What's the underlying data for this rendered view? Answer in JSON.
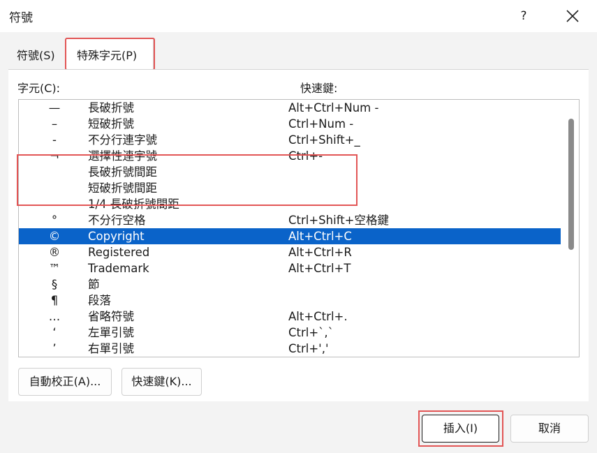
{
  "window": {
    "title": "符號",
    "help": "?"
  },
  "tabs": [
    {
      "label": "符號(S)"
    },
    {
      "label": "特殊字元(P)"
    }
  ],
  "columns": {
    "character": "字元(C):",
    "shortcut": "快速鍵:"
  },
  "rows": [
    {
      "symbol": "—",
      "name": "長破折號",
      "shortcut": "Alt+Ctrl+Num -"
    },
    {
      "symbol": "–",
      "name": "短破折號",
      "shortcut": "Ctrl+Num -"
    },
    {
      "symbol": "-",
      "name": "不分行連字號",
      "shortcut": "Ctrl+Shift+_"
    },
    {
      "symbol": "¬",
      "name": "選擇性連字號",
      "shortcut": "Ctrl+-"
    },
    {
      "symbol": "",
      "name": "長破折號間距",
      "shortcut": ""
    },
    {
      "symbol": "",
      "name": "短破折號間距",
      "shortcut": ""
    },
    {
      "symbol": "",
      "name": "1/4 長破折號間距",
      "shortcut": ""
    },
    {
      "symbol": "°",
      "name": "不分行空格",
      "shortcut": "Ctrl+Shift+空格鍵"
    },
    {
      "symbol": "©",
      "name": "Copyright",
      "shortcut": "Alt+Ctrl+C",
      "selected": true
    },
    {
      "symbol": "®",
      "name": "Registered",
      "shortcut": "Alt+Ctrl+R"
    },
    {
      "symbol": "™",
      "name": "Trademark",
      "shortcut": "Alt+Ctrl+T"
    },
    {
      "symbol": "§",
      "name": "節",
      "shortcut": ""
    },
    {
      "symbol": "¶",
      "name": "段落",
      "shortcut": ""
    },
    {
      "symbol": "…",
      "name": "省略符號",
      "shortcut": "Alt+Ctrl+."
    },
    {
      "symbol": "‘",
      "name": "左單引號",
      "shortcut": "Ctrl+`,`"
    },
    {
      "symbol": "’",
      "name": "右單引號",
      "shortcut": "Ctrl+','"
    }
  ],
  "buttons": {
    "autocorrect": "自動校正(A)...",
    "shortcut_key": "快速鍵(K)...",
    "insert": "插入(I)",
    "cancel": "取消"
  },
  "colors": {
    "selection": "#0a63c9",
    "annotation": "#e25555"
  }
}
